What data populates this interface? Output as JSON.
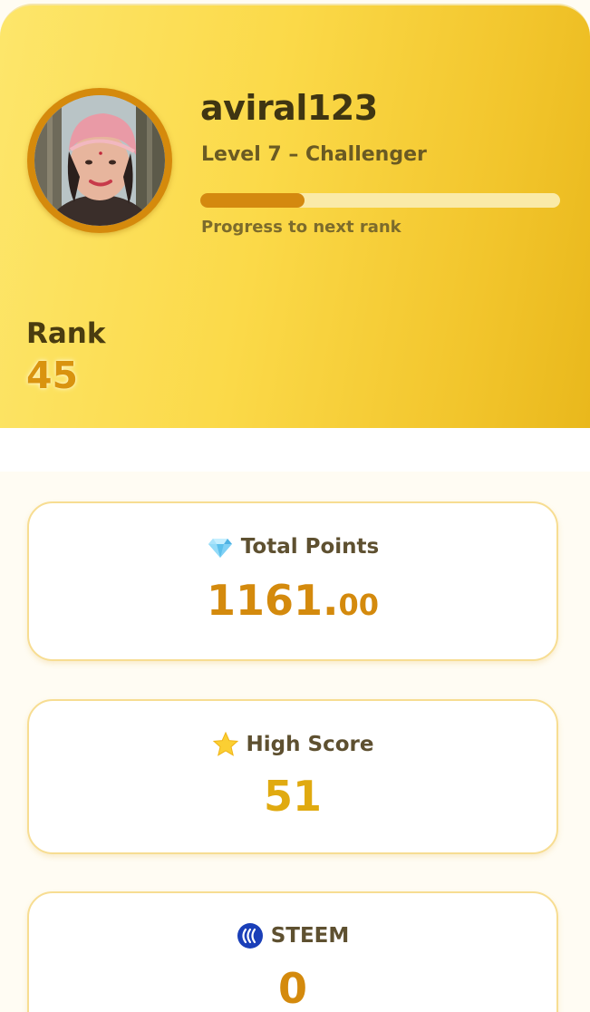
{
  "profile": {
    "username": "aviral123",
    "level_text": "Level 7 – Challenger",
    "progress_fraction": 0.29,
    "progress_label": "Progress to next rank",
    "rank_label": "Rank",
    "rank_value": "45"
  },
  "stats": {
    "total_points": {
      "icon": "gem-icon",
      "title": "Total Points",
      "value_int": "1161.",
      "value_dec": "00"
    },
    "high_score": {
      "icon": "star-icon",
      "title": "High Score",
      "value": "51"
    },
    "steem": {
      "icon": "steem-logo-icon",
      "title": "STEEM",
      "value": "0"
    }
  },
  "colors": {
    "accent": "#d4890f",
    "header_start": "#fde66b",
    "header_end": "#e9b81c",
    "card_border": "#f7dd92"
  }
}
